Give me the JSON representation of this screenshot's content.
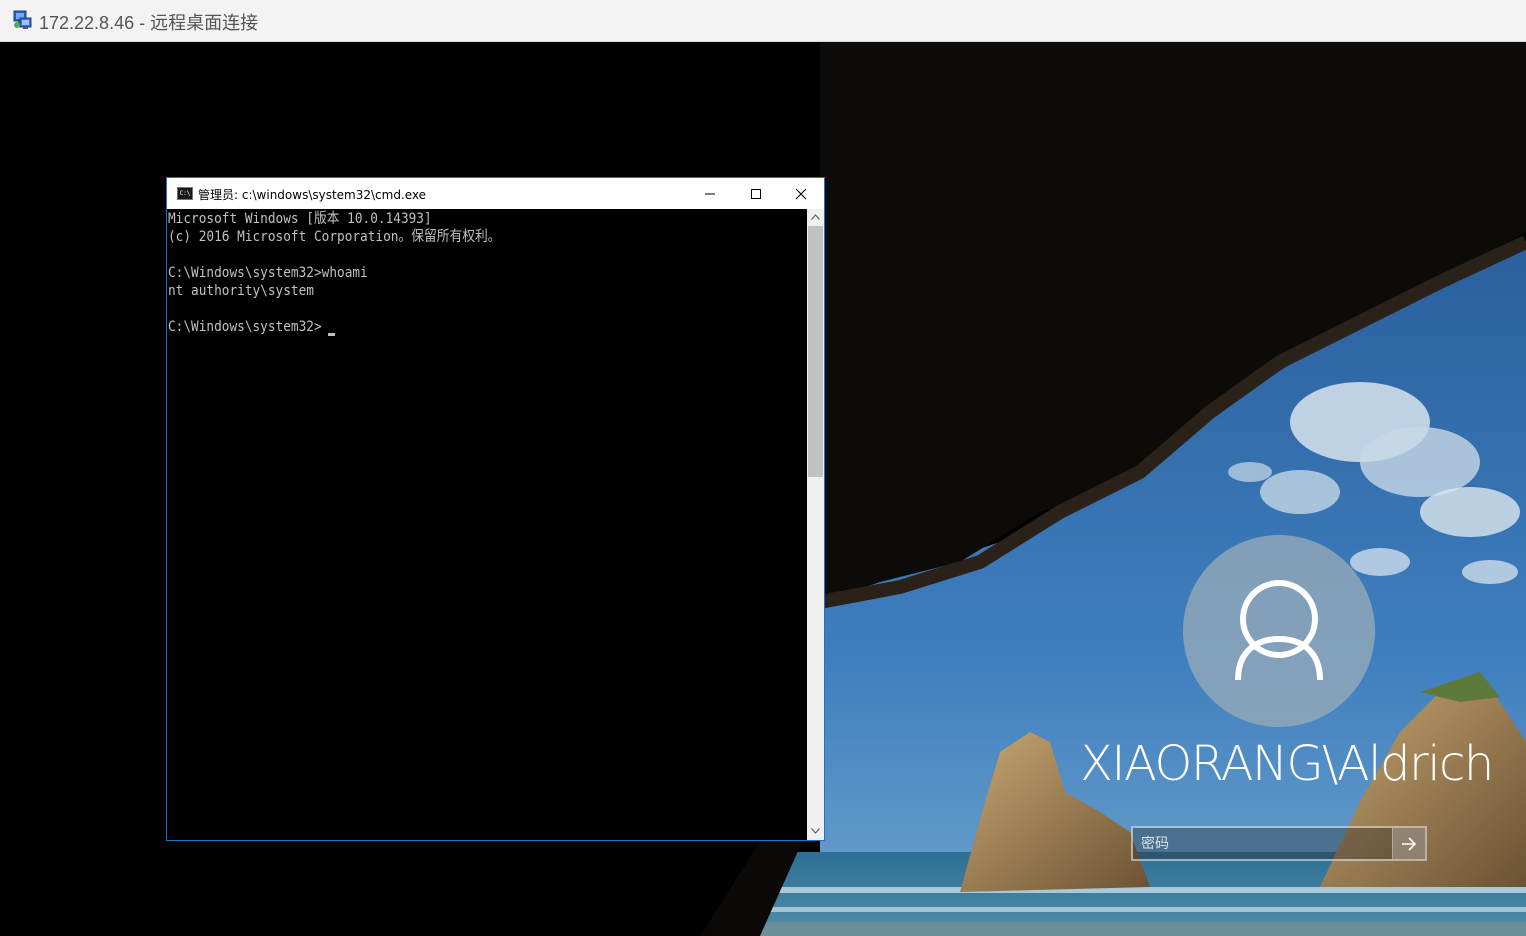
{
  "rdp": {
    "title": "172.22.8.46 - 远程桌面连接"
  },
  "cmd": {
    "title": "管理员: c:\\windows\\system32\\cmd.exe",
    "icon_text": "C:\\",
    "lines": [
      "Microsoft Windows [版本 10.0.14393]",
      "(c) 2016 Microsoft Corporation。保留所有权利。",
      "",
      "C:\\Windows\\system32>whoami",
      "nt authority\\system",
      "",
      "C:\\Windows\\system32>"
    ]
  },
  "lockscreen": {
    "username": "XIAORANG\\Aldrich",
    "password_placeholder": "密码",
    "submit_icon": "arrow-right-icon",
    "avatar_icon": "user-icon"
  }
}
